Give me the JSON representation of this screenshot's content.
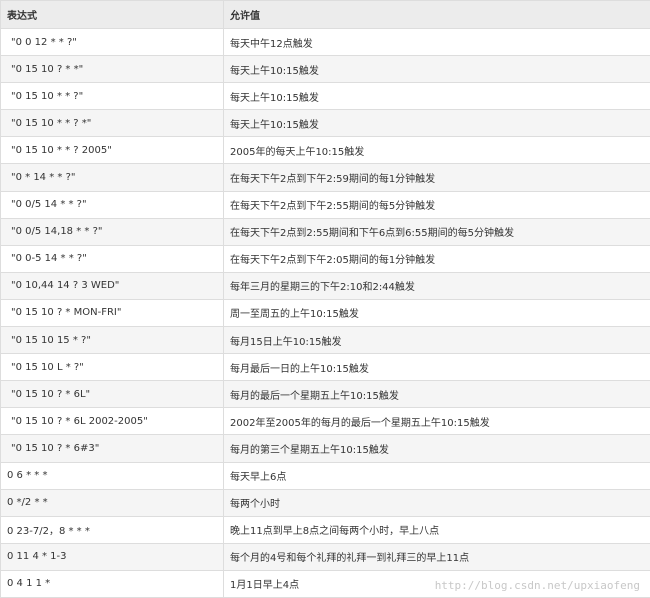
{
  "table": {
    "headers": [
      "表达式",
      "允许值"
    ],
    "rows": [
      {
        "expr": "\"0 0 12 * * ?\"",
        "value": "每天中午12点触发"
      },
      {
        "expr": "\"0 15 10 ? * *\"",
        "value": "每天上午10:15触发"
      },
      {
        "expr": "\"0 15 10 * * ?\"",
        "value": "每天上午10:15触发"
      },
      {
        "expr": "\"0 15 10 * * ? *\"",
        "value": "每天上午10:15触发"
      },
      {
        "expr": "\"0 15 10 * * ? 2005\"",
        "value": "2005年的每天上午10:15触发"
      },
      {
        "expr": "\"0 * 14 * * ?\"",
        "value": "在每天下午2点到下午2:59期间的每1分钟触发"
      },
      {
        "expr": "\"0 0/5 14 * * ?\"",
        "value": "在每天下午2点到下午2:55期间的每5分钟触发"
      },
      {
        "expr": "\"0 0/5 14,18 * * ?\"",
        "value": "在每天下午2点到2:55期间和下午6点到6:55期间的每5分钟触发"
      },
      {
        "expr": "\"0 0-5 14 * * ?\"",
        "value": "在每天下午2点到下午2:05期间的每1分钟触发"
      },
      {
        "expr": "\"0 10,44 14 ? 3 WED\"",
        "value": "每年三月的星期三的下午2:10和2:44触发"
      },
      {
        "expr": "\"0 15 10 ? * MON-FRI\"",
        "value": "周一至周五的上午10:15触发"
      },
      {
        "expr": "\"0 15 10 15 * ?\"",
        "value": "每月15日上午10:15触发"
      },
      {
        "expr": "\"0 15 10 L * ?\"",
        "value": "每月最后一日的上午10:15触发"
      },
      {
        "expr": "\"0 15 10 ? * 6L\"",
        "value": "每月的最后一个星期五上午10:15触发"
      },
      {
        "expr": "\"0 15 10 ? * 6L 2002-2005\"",
        "value": "2002年至2005年的每月的最后一个星期五上午10:15触发"
      },
      {
        "expr": "\"0 15 10 ? * 6#3\"",
        "value": "每月的第三个星期五上午10:15触发"
      },
      {
        "expr": "0 6 * * *",
        "value": "每天早上6点"
      },
      {
        "expr": "0 */2 * *",
        "value": "每两个小时"
      },
      {
        "expr": "0 23-7/2，8 * * *",
        "value": "晚上11点到早上8点之间每两个小时，早上八点"
      },
      {
        "expr": "0 11 4 * 1-3",
        "value": "每个月的4号和每个礼拜的礼拜一到礼拜三的早上11点"
      },
      {
        "expr": "0 4 1 1 *",
        "value": "1月1日早上4点"
      }
    ]
  },
  "watermark": "http://blog.csdn.net/upxiaofeng"
}
